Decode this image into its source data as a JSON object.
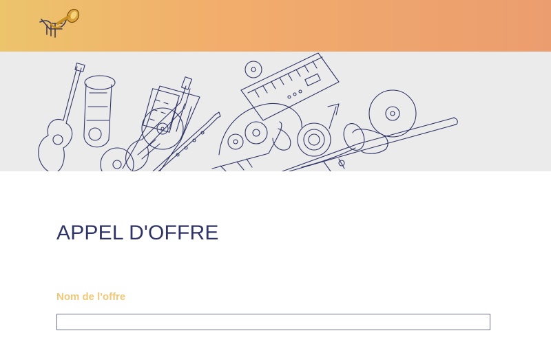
{
  "header": {
    "logo_icon": "trumpet-logo-icon",
    "gradient_colors": [
      "#ecc46c",
      "#f2ad6c",
      "#eb9d6f"
    ]
  },
  "banner": {
    "illustration_icon": "musical-instruments-illustration",
    "background_color": "#ebebeb",
    "line_color": "#2f3366"
  },
  "main": {
    "title": "APPEL D'OFFRE",
    "title_color": "#2f3366",
    "form": {
      "offer_name_label": "Nom de l'offre",
      "label_color": "#f0c878",
      "offer_name_value": ""
    }
  }
}
